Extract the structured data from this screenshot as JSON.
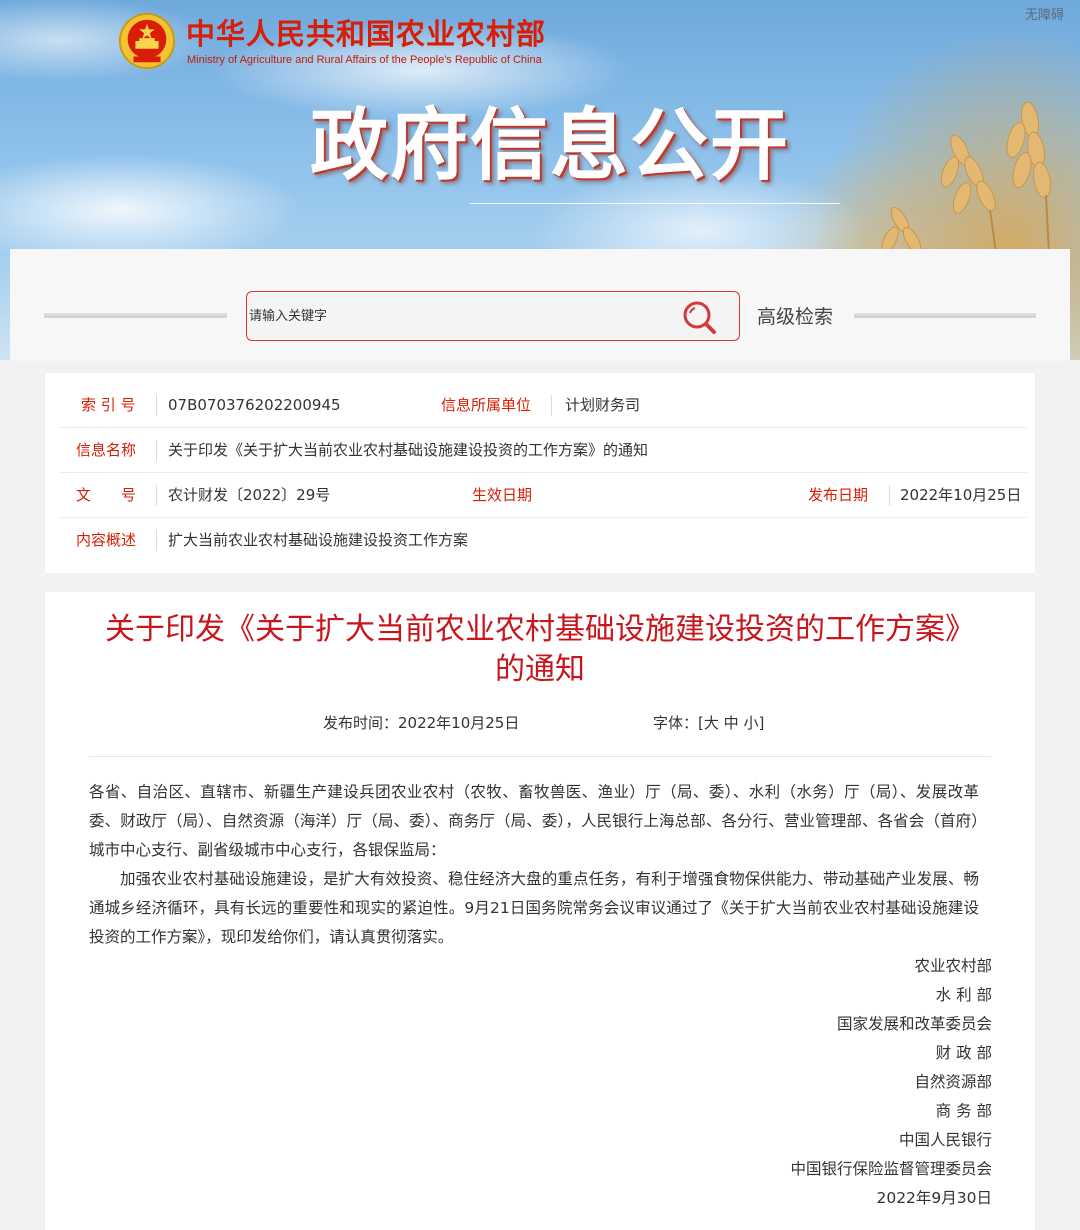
{
  "header": {
    "ministry_cn": "中华人民共和国农业农村部",
    "ministry_en": "Ministry of Agriculture and Rural Affairs of the People's Republic of China",
    "accessibility": "无障碍",
    "banner_title": "政府信息公开",
    "emblem_icon": "national-emblem-icon"
  },
  "search": {
    "placeholder": "请输入关键字",
    "search_icon": "search-icon",
    "advanced_label": "高级检索"
  },
  "info": {
    "index_label": "索 引 号",
    "index_value": "07B070376202200945",
    "unit_label": "信息所属单位",
    "unit_value": "计划财务司",
    "name_label": "信息名称",
    "name_value": "关于印发《关于扩大当前农业农村基础设施建设投资的工作方案》的通知",
    "docno_label": "文　　号",
    "docno_value": "农计财发〔2022〕29号",
    "effective_label": "生效日期",
    "effective_value": "",
    "publish_label": "发布日期",
    "publish_value": "2022年10月25日",
    "summary_label": "内容概述",
    "summary_value": "扩大当前农业农村基础设施建设投资工作方案"
  },
  "document": {
    "title_line1": "关于印发《关于扩大当前农业农村基础设施建设投资的工作方案》",
    "title_line2": "的通知",
    "publish_time": "发布时间：2022年10月25日",
    "font_size_label": "字体：",
    "size_open": "[",
    "size_large": "大",
    "size_medium": "中",
    "size_small": "小",
    "size_close": "]",
    "paragraph1": "各省、自治区、直辖市、新疆生产建设兵团农业农村（农牧、畜牧兽医、渔业）厅（局、委）、水利（水务）厅（局）、发展改革委、财政厅（局）、自然资源（海洋）厅（局、委）、商务厅（局、委），人民银行上海总部、各分行、营业管理部、各省会（首府）城市中心支行、副省级城市中心支行，各银保监局：",
    "paragraph2": "加强农业农村基础设施建设，是扩大有效投资、稳住经济大盘的重点任务，有利于增强食物保供能力、带动基础产业发展、畅通城乡经济循环，具有长远的重要性和现实的紧迫性。9月21日国务院常务会议审议通过了《关于扩大当前农业农村基础设施建设投资的工作方案》，现印发给你们，请认真贯彻落实。",
    "signers": [
      "农业农村部",
      "水 利 部",
      "国家发展和改革委员会",
      "财 政 部",
      "自然资源部",
      "商 务 部",
      "中国人民银行",
      "中国银行保险监督管理委员会",
      "2022年9月30日"
    ]
  },
  "colors": {
    "brand_red": "#d81e06",
    "title_red": "#c8161d",
    "search_border": "#d43a3a"
  }
}
